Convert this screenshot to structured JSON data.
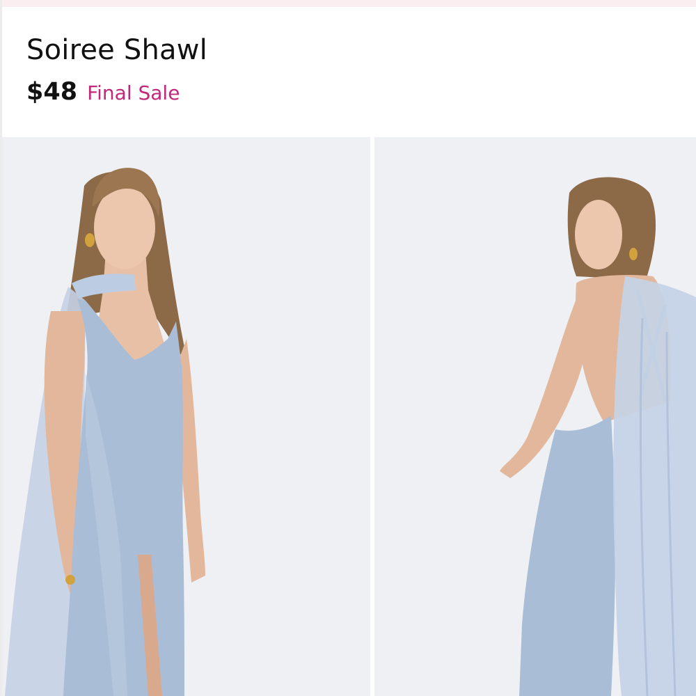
{
  "product": {
    "title": "Soiree Shawl",
    "price": "$48",
    "sale_label": "Final Sale"
  },
  "gallery": {
    "images": [
      {
        "name": "front-view"
      },
      {
        "name": "back-view"
      }
    ]
  },
  "colors": {
    "sale_accent": "#c1287a",
    "dress": "#a9bdd6",
    "shawl": "#c4d2e6",
    "background": "#eef0f4"
  }
}
